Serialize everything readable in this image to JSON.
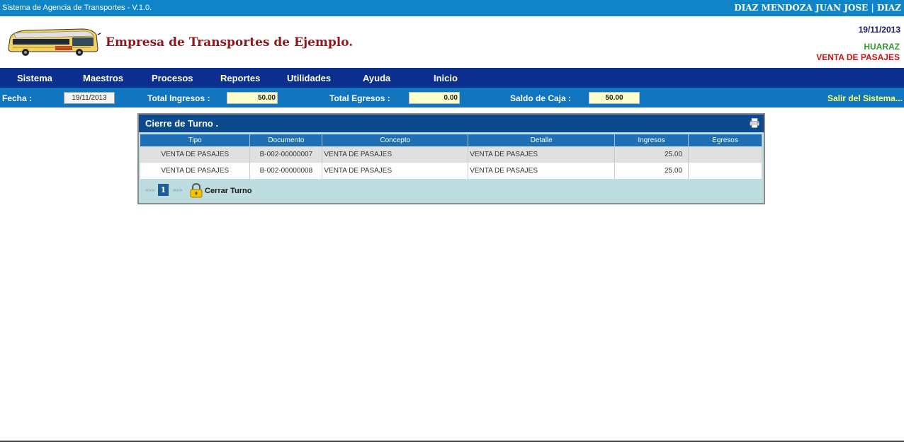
{
  "topbar": {
    "system": "Sistema de Agencia de Transportes - V.1.0.",
    "user": "DIAZ MENDOZA JUAN JOSE | DIAZ"
  },
  "header": {
    "company": "Empresa de Transportes de Ejemplo.",
    "date": "19/11/2013",
    "city": "HUARAZ",
    "module": "VENTA DE PASAJES"
  },
  "menu": [
    "Sistema",
    "Maestros",
    "Procesos",
    "Reportes",
    "Utilidades",
    "Ayuda",
    "Inicio"
  ],
  "status": {
    "fecha_label": "Fecha :",
    "fecha_value": "19/11/2013",
    "ingresos_label": "Total Ingresos :",
    "ingresos_value": "50.00",
    "egresos_label": "Total Egresos :",
    "egresos_value": "0.00",
    "saldo_label": "Saldo de Caja :",
    "saldo_value": "50.00",
    "exit": "Salir del Sistema..."
  },
  "panel": {
    "title": "Cierre de Turno .",
    "columns": [
      "Tipo",
      "Documento",
      "Concepto",
      "Detalle",
      "Ingresos",
      "Egresos"
    ],
    "rows": [
      [
        "VENTA DE PASAJES",
        "B-002-00000007",
        "VENTA DE PASAJES",
        "VENTA DE PASAJES",
        "25.00",
        ""
      ],
      [
        "VENTA DE PASAJES",
        "B-002-00000008",
        "VENTA DE PASAJES",
        "VENTA DE PASAJES",
        "25.00",
        ""
      ]
    ],
    "pager": {
      "prev": "«««",
      "page": "1",
      "next": "»»»",
      "close_label": "Cerrar Turno"
    }
  },
  "icons": {
    "printer": "printer-icon",
    "lock": "lock-icon",
    "bus_logo": "bus-logo"
  },
  "colors": {
    "topbar": "#0f85c8",
    "menubar": "#0a2f8f",
    "statusbar": "#1176bf",
    "panel_title": "#0b4a8c"
  }
}
